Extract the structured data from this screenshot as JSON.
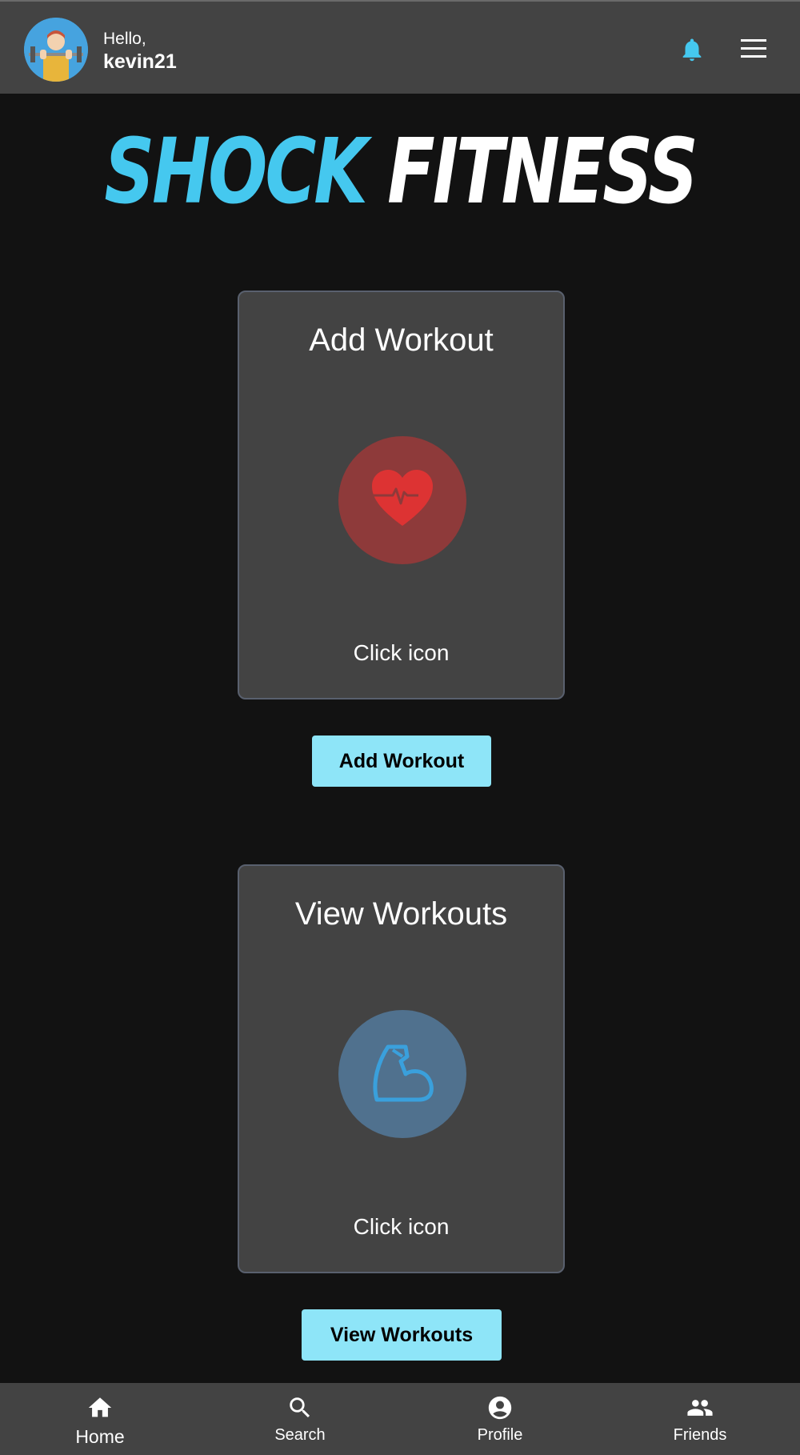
{
  "header": {
    "greeting": "Hello,",
    "username": "kevin21",
    "avatar_icon": "weightlifter-avatar",
    "notification_icon": "bell-icon",
    "menu_icon": "hamburger-menu-icon"
  },
  "logo": {
    "part1": "SHOCK",
    "part2": "FITNESS"
  },
  "cards": [
    {
      "title": "Add Workout",
      "icon": "heart-pulse-icon",
      "hint": "Click icon",
      "button_label": "Add Workout"
    },
    {
      "title": "View Workouts",
      "icon": "flexed-bicep-icon",
      "hint": "Click icon",
      "button_label": "View Workouts"
    }
  ],
  "bottom_nav": [
    {
      "label": "Home",
      "icon": "home-icon",
      "active": true
    },
    {
      "label": "Search",
      "icon": "search-icon",
      "active": false
    },
    {
      "label": "Profile",
      "icon": "profile-icon",
      "active": false
    },
    {
      "label": "Friends",
      "icon": "friends-icon",
      "active": false
    }
  ],
  "colors": {
    "accent": "#45c8ef",
    "button": "#8ee5f8",
    "background": "#121212",
    "surface": "#434343",
    "heart": "#dd3333",
    "bicep": "#3aa0dc"
  }
}
